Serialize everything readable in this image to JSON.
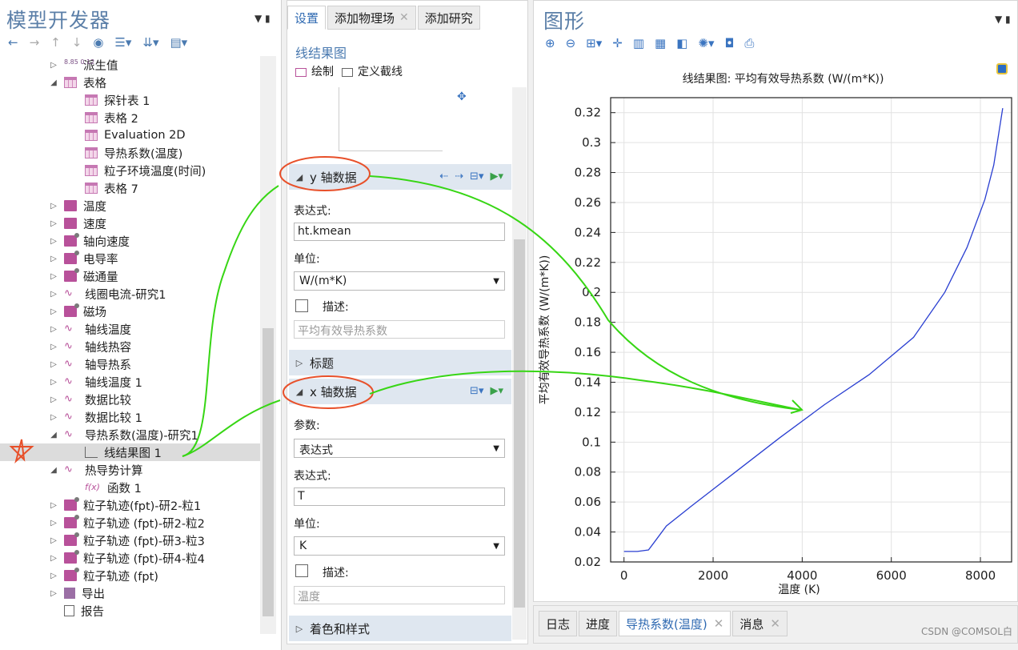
{
  "left": {
    "title": "模型开发器",
    "tree": [
      {
        "label": "派生值",
        "depth": 1,
        "exp": "▷",
        "icon": "dv"
      },
      {
        "label": "表格",
        "depth": 1,
        "exp": "◢",
        "icon": "tbl"
      },
      {
        "label": "探针表 1",
        "depth": 2,
        "exp": "",
        "icon": "tbl"
      },
      {
        "label": "表格 2",
        "depth": 2,
        "exp": "",
        "icon": "tbl"
      },
      {
        "label": "Evaluation 2D",
        "depth": 2,
        "exp": "",
        "icon": "tbl"
      },
      {
        "label": "导热系数(温度)",
        "depth": 2,
        "exp": "",
        "icon": "tbl"
      },
      {
        "label": "粒子环境温度(时间)",
        "depth": 2,
        "exp": "",
        "icon": "tbl"
      },
      {
        "label": "表格 7",
        "depth": 2,
        "exp": "",
        "icon": "tbl"
      },
      {
        "label": "温度",
        "depth": 1,
        "exp": "▷",
        "icon": "sq"
      },
      {
        "label": "速度",
        "depth": 1,
        "exp": "▷",
        "icon": "sq"
      },
      {
        "label": "轴向速度",
        "depth": 1,
        "exp": "▷",
        "icon": "sqs"
      },
      {
        "label": "电导率",
        "depth": 1,
        "exp": "▷",
        "icon": "sqs"
      },
      {
        "label": "磁通量",
        "depth": 1,
        "exp": "▷",
        "icon": "sqs"
      },
      {
        "label": "线圈电流-研究1",
        "depth": 1,
        "exp": "▷",
        "icon": "wave"
      },
      {
        "label": "磁场",
        "depth": 1,
        "exp": "▷",
        "icon": "sqs"
      },
      {
        "label": "轴线温度",
        "depth": 1,
        "exp": "▷",
        "icon": "wave"
      },
      {
        "label": "轴线热容",
        "depth": 1,
        "exp": "▷",
        "icon": "wave"
      },
      {
        "label": "轴导热系",
        "depth": 1,
        "exp": "▷",
        "icon": "wave"
      },
      {
        "label": "轴线温度 1",
        "depth": 1,
        "exp": "▷",
        "icon": "wave"
      },
      {
        "label": "数据比较",
        "depth": 1,
        "exp": "▷",
        "icon": "wave"
      },
      {
        "label": "数据比较 1",
        "depth": 1,
        "exp": "▷",
        "icon": "wave"
      },
      {
        "label": "导热系数(温度)-研究1",
        "depth": 1,
        "exp": "◢",
        "icon": "wave"
      },
      {
        "label": "线结果图 1",
        "depth": 2,
        "exp": "",
        "icon": "line",
        "selected": true
      },
      {
        "label": "热导势计算",
        "depth": 1,
        "exp": "◢",
        "icon": "wave"
      },
      {
        "label": "函数 1",
        "depth": 2,
        "exp": "",
        "icon": "fx"
      },
      {
        "label": "粒子轨迹(fpt)-研2-粒1",
        "depth": 1,
        "exp": "▷",
        "icon": "sqs"
      },
      {
        "label": "粒子轨迹 (fpt)-研2-粒2",
        "depth": 1,
        "exp": "▷",
        "icon": "sqs"
      },
      {
        "label": "粒子轨迹 (fpt)-研3-粒3",
        "depth": 1,
        "exp": "▷",
        "icon": "sqs"
      },
      {
        "label": "粒子轨迹 (fpt)-研4-粒4",
        "depth": 1,
        "exp": "▷",
        "icon": "sqs"
      },
      {
        "label": "粒子轨迹 (fpt)",
        "depth": 1,
        "exp": "▷",
        "icon": "sqs"
      },
      {
        "label": "导出",
        "depth": 1,
        "exp": "▷",
        "icon": "exp2"
      },
      {
        "label": "报告",
        "depth": 1,
        "exp": "",
        "icon": "rep"
      }
    ]
  },
  "mid": {
    "tabs": [
      "设置",
      "添加物理场",
      "添加研究"
    ],
    "title": "线结果图",
    "plot_label": "绘制",
    "cutline_label": "定义截线",
    "y_section": "y 轴数据",
    "y_expr_label": "表达式:",
    "y_expr": "ht.kmean",
    "y_unit_label": "单位:",
    "y_unit": "W/(m*K)",
    "y_desc_label": "描述:",
    "y_desc_placeholder": "平均有效导热系数",
    "title_section": "标题",
    "x_section": "x 轴数据",
    "x_param_label": "参数:",
    "x_param": "表达式",
    "x_expr_label": "表达式:",
    "x_expr": "T",
    "x_unit_label": "单位:",
    "x_unit": "K",
    "x_desc_label": "描述:",
    "x_desc_placeholder": "温度",
    "color_section": "着色和样式"
  },
  "right": {
    "title": "图形"
  },
  "bottom": {
    "tabs": [
      "日志",
      "进度",
      "导热系数(温度)",
      "消息"
    ],
    "watermark": "CSDN @COMSOL白"
  },
  "chart_data": {
    "type": "line",
    "title": "线结果图: 平均有效导热系数 (W/(m*K))",
    "xlabel": "温度 (K)",
    "ylabel": "平均有效导热系数 (W/(m*K))",
    "xlim": [
      -300,
      8700
    ],
    "ylim": [
      0.02,
      0.33
    ],
    "xticks": [
      0,
      2000,
      4000,
      6000,
      8000
    ],
    "yticks": [
      0.02,
      0.04,
      0.06,
      0.08,
      0.1,
      0.12,
      0.14,
      0.16,
      0.18,
      0.2,
      0.22,
      0.24,
      0.26,
      0.28,
      0.3,
      0.32
    ],
    "grid": true,
    "color": "#2a3fd1",
    "series": [
      {
        "x": [
          0,
          300,
          550,
          700,
          950,
          1500,
          2500,
          3500,
          4500,
          5500,
          6500,
          7200,
          7700,
          8100,
          8300,
          8500
        ],
        "y": [
          0.027,
          0.027,
          0.028,
          0.034,
          0.044,
          0.057,
          0.08,
          0.103,
          0.125,
          0.145,
          0.17,
          0.2,
          0.23,
          0.262,
          0.285,
          0.323
        ]
      }
    ]
  }
}
